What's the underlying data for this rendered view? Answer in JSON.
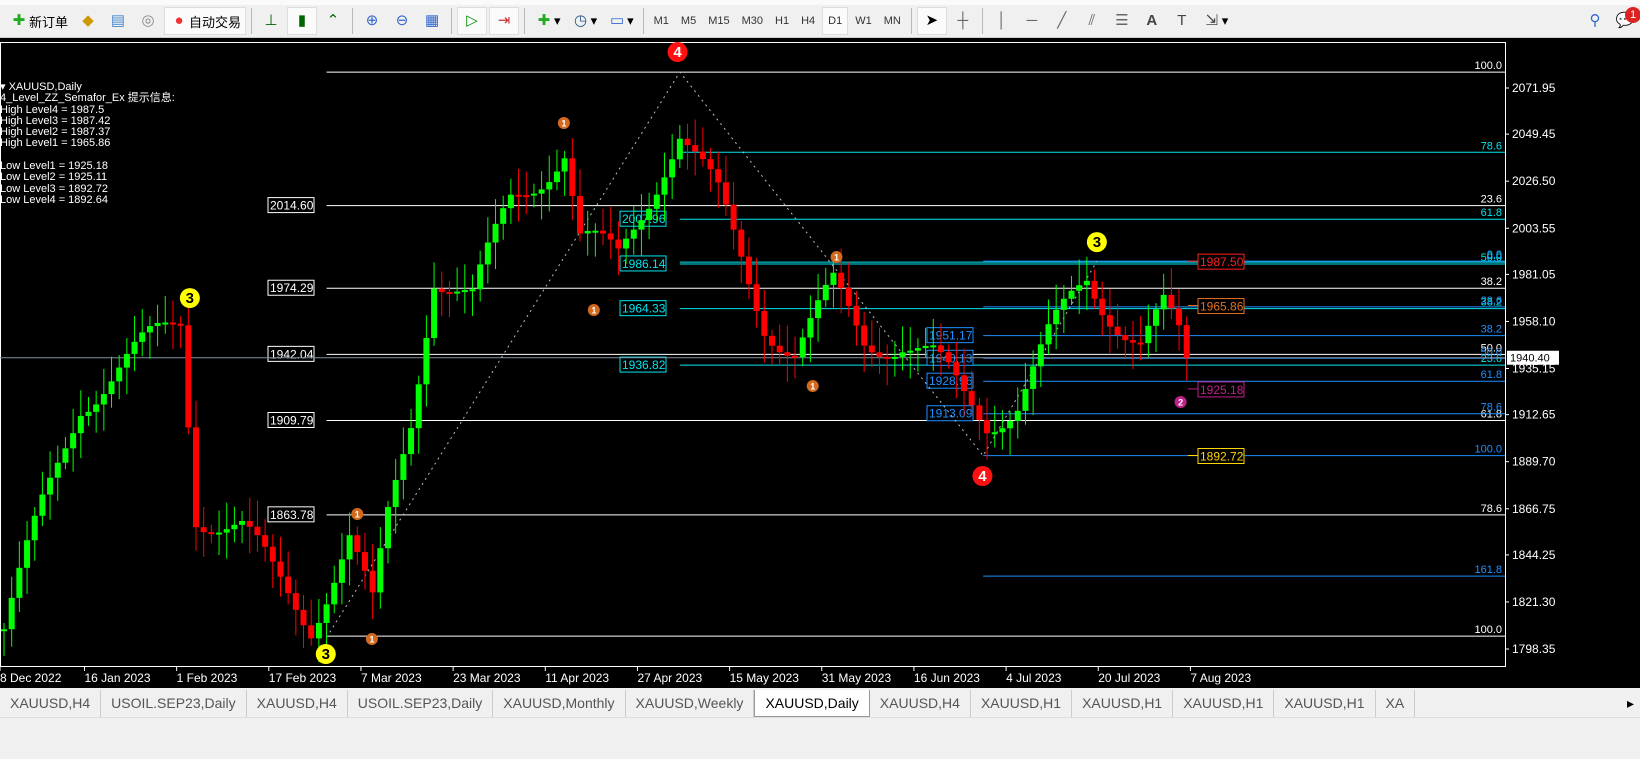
{
  "toolbar": {
    "new_order": "新订单",
    "auto_trade": "自动交易",
    "timeframes": [
      "M1",
      "M5",
      "M15",
      "M30",
      "H1",
      "H4",
      "D1",
      "W1",
      "MN"
    ],
    "active_timeframe": "D1",
    "notification_count": "1"
  },
  "info": {
    "symbol": "XAUUSD,Daily",
    "indicator": "4_Level_ZZ_Semafor_Ex 提示信息:",
    "lines": [
      "High Level4 = 1987.5",
      "High Level3 = 1987.42",
      "High Level2 = 1987.37",
      "High Level1 = 1965.86",
      "",
      "Low Level1 = 1925.18",
      "Low Level2 = 1925.11",
      "Low Level3 = 1892.72",
      "Low Level4 = 1892.64"
    ]
  },
  "tabs": [
    "XAUUSD,H4",
    "USOIL.SEP23,Daily",
    "XAUUSD,H4",
    "USOIL.SEP23,Daily",
    "XAUUSD,Monthly",
    "XAUUSD,Weekly",
    "XAUUSD,Daily",
    "XAUUSD,H4",
    "XAUUSD,H1",
    "XAUUSD,H1",
    "XAUUSD,H1",
    "XAUUSD,H1",
    "XA"
  ],
  "active_tab": 6,
  "chart_data": {
    "type": "candlestick",
    "symbol": "XAUUSD",
    "timeframe": "Daily",
    "ylim": [
      1798.35,
      2071.95
    ],
    "bars": 155,
    "price_ticks": [
      "2071.95",
      "2049.45",
      "2026.50",
      "2003.55",
      "1981.05",
      "1958.10",
      "1935.15",
      "1912.65",
      "1889.70",
      "1866.75",
      "1844.25",
      "1821.30",
      "1798.35"
    ],
    "date_ticks": [
      [
        0,
        "8 Dec 2022"
      ],
      [
        11,
        "16 Jan 2023"
      ],
      [
        23,
        "1 Feb 2023"
      ],
      [
        35,
        "17 Feb 2023"
      ],
      [
        47,
        "7 Mar 2023"
      ],
      [
        59,
        "23 Mar 2023"
      ],
      [
        71,
        "11 Apr 2023"
      ],
      [
        83,
        "27 Apr 2023"
      ],
      [
        95,
        "15 May 2023"
      ],
      [
        107,
        "31 May 2023"
      ],
      [
        119,
        "16 Jun 2023"
      ],
      [
        131,
        "4 Jul 2023"
      ],
      [
        143,
        "20 Jul 2023"
      ],
      [
        155,
        "7 Aug 2023"
      ]
    ],
    "close_path": [
      [
        0,
        1808
      ],
      [
        5,
        1866
      ],
      [
        10,
        1920
      ],
      [
        18,
        1944
      ],
      [
        23,
        1959
      ],
      [
        25,
        1866
      ],
      [
        31,
        1856
      ],
      [
        35,
        1834
      ],
      [
        40,
        1812
      ],
      [
        45,
        1852
      ],
      [
        48,
        1817
      ],
      [
        50,
        1861
      ],
      [
        53,
        1910
      ],
      [
        56,
        1983
      ],
      [
        61,
        1968
      ],
      [
        66,
        2017
      ],
      [
        73,
        2042
      ],
      [
        75,
        1998
      ],
      [
        80,
        1988
      ],
      [
        86,
        2037
      ],
      [
        88,
        2051
      ],
      [
        93,
        2017
      ],
      [
        96,
        1988
      ],
      [
        99,
        1959
      ],
      [
        103,
        1944
      ],
      [
        108,
        1973
      ],
      [
        112,
        1949
      ],
      [
        117,
        1949
      ],
      [
        121,
        1939
      ],
      [
        125,
        1920
      ],
      [
        128,
        1910
      ],
      [
        132,
        1920
      ],
      [
        136,
        1949
      ],
      [
        141,
        1978
      ],
      [
        143,
        1968
      ],
      [
        148,
        1949
      ],
      [
        151,
        1963
      ],
      [
        154,
        1940.4
      ]
    ],
    "current_price": "1940.40",
    "zigzag": [
      [
        42,
        1804
      ],
      [
        88,
        2079.7
      ],
      [
        127.5,
        1892.6
      ],
      [
        142.3,
        1987.5
      ]
    ],
    "fib_sets": [
      {
        "color": "#ffffff",
        "start": 42,
        "levels": [
          [
            "100.0",
            2079.7
          ],
          [
            "23.6",
            2014.6,
            "2014.60"
          ],
          [
            "38.2",
            1974.29,
            "1974.29"
          ],
          [
            "50.0",
            1942.04,
            "1942.04"
          ],
          [
            "61.8",
            1909.79,
            "1909.79"
          ],
          [
            "78.6",
            1863.78,
            "1863.78"
          ],
          [
            "100.0",
            1804.6
          ]
        ]
      },
      {
        "color": "#00e5ee",
        "start": 88,
        "levels": [
          [
            "78.6",
            2040.6
          ],
          [
            "61.8",
            2007.96,
            "2007.96"
          ],
          [
            "50.0",
            1986.14,
            "1986.14"
          ],
          [
            "38.2",
            1964.33,
            "1964.33"
          ],
          [
            "23.6",
            1936.82,
            "1936.82"
          ],
          [
            "0.0",
            1987.0
          ]
        ]
      },
      {
        "color": "#1e90ff",
        "start": 127.5,
        "levels": [
          [
            "0.0",
            1987.5
          ],
          [
            "23.6",
            1965.2
          ],
          [
            "38.2",
            1951.17,
            "1951.17"
          ],
          [
            "50.0",
            1940.13,
            "1940.13"
          ],
          [
            "61.8",
            1928.96,
            "1928.96"
          ],
          [
            "78.6",
            1913.09,
            "1913.09"
          ],
          [
            "100.0",
            1892.64
          ],
          [
            "161.8",
            1833.9
          ]
        ]
      }
    ],
    "semafor_levels": [
      [
        "1987.50",
        "#ff2020",
        1987.5
      ],
      [
        "1965.86",
        "#e07020",
        1965.86
      ],
      [
        "1925.18",
        "#c0208a",
        1925.18
      ],
      [
        "1892.72",
        "#ffd700",
        1892.72
      ]
    ],
    "semafor_markers": [
      [
        "4",
        "#ff1010",
        87.7,
        2089.5
      ],
      [
        "4",
        "#ff1010",
        127.4,
        1882.7
      ],
      [
        "3",
        "#ffff00",
        24.2,
        1969.5
      ],
      [
        "3",
        "#ffff00",
        41.9,
        1795.9
      ],
      [
        "3",
        "#ffff00",
        142.3,
        1996.8
      ],
      [
        "1",
        "#d2691e",
        72.9,
        2054.9
      ],
      [
        "1",
        "#d2691e",
        76.8,
        1963.7
      ],
      [
        "1",
        "#d2691e",
        105.3,
        1926.6
      ],
      [
        "1",
        "#d2691e",
        108.4,
        1989.5
      ],
      [
        "1",
        "#d2691e",
        46,
        1864.2
      ],
      [
        "1",
        "#d2691e",
        47.9,
        1803.2
      ],
      [
        "2",
        "#c0208a",
        153.2,
        1918.8
      ]
    ]
  }
}
